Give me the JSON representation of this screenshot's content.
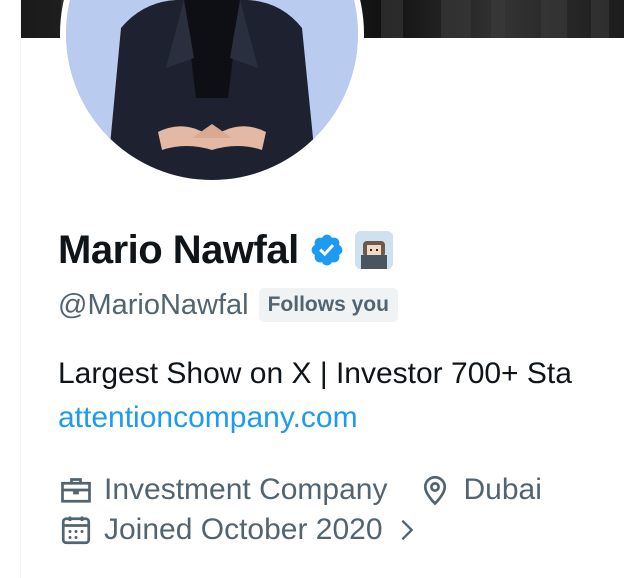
{
  "profile": {
    "name": "Mario Nawfal",
    "handle": "@MarioNawfal",
    "follows_you": "Follows you",
    "bio": "Largest Show on X | Investor 700+ Sta",
    "website": "attentioncompany.com",
    "category": "Investment Company",
    "location": "Dubai",
    "joined": "Joined October 2020"
  },
  "icons": {
    "verified": "verified-badge-icon",
    "affiliation": "affiliation-badge-icon",
    "category": "briefcase-icon",
    "location": "location-pin-icon",
    "joined": "calendar-icon",
    "more": "chevron-right-icon"
  },
  "colors": {
    "accent": "#1d9bf0",
    "secondary_text": "#536471",
    "badge_bg": "#eff3f4"
  }
}
